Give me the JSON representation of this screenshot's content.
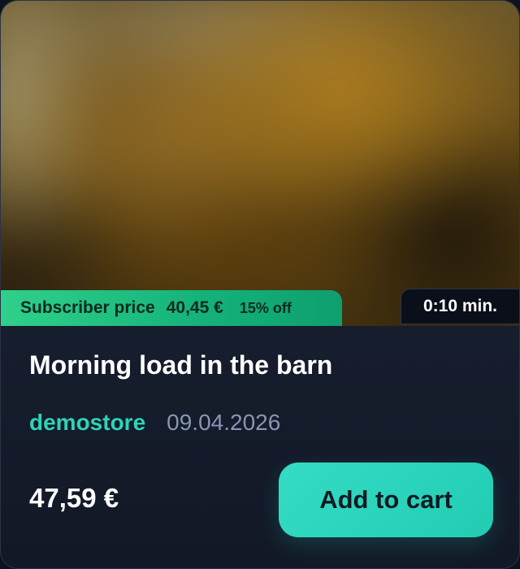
{
  "subscriber": {
    "label": "Subscriber price",
    "price": "40,45 €",
    "discount": "15% off"
  },
  "video": {
    "duration": "0:10 min."
  },
  "product": {
    "title": "Morning load in the barn",
    "store": "demostore",
    "date": "09.04.2026",
    "price": "47,59 €"
  },
  "actions": {
    "add_to_cart": "Add to cart"
  },
  "colors": {
    "accent": "#2ed3b7",
    "subscriber_badge": "#1fbf82",
    "card_background": "#1a2233"
  }
}
